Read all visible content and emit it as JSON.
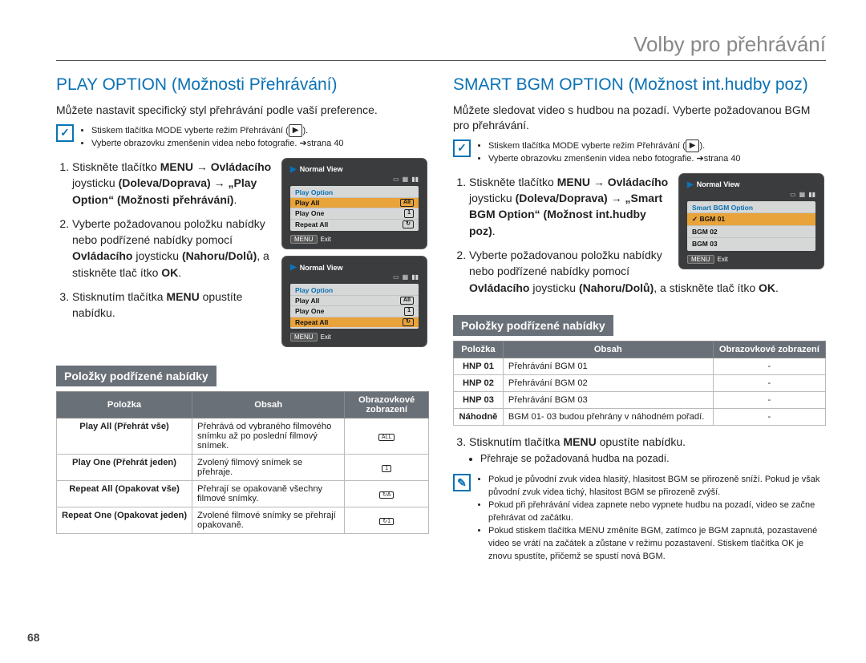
{
  "header": {
    "title": "Volby pro přehrávání"
  },
  "page_number": "68",
  "left": {
    "heading": "PLAY OPTION (Možnosti Přehrávání)",
    "intro": "Můžete nastavit specifický styl přehrávání podle vaší preference.",
    "note1": "Stiskem tlačítka MODE vyberte režim Přehrávání (",
    "note1b": ").",
    "note2": "Vyberte obrazovku zmenšenin videa nebo fotografie. ➔strana 40",
    "steps": {
      "s1a": "Stiskněte tlačítko ",
      "s1b_menu": "MENU",
      "s1c": " → ",
      "s1d": "Ovládacího",
      "s1e": " joysticku ",
      "s1f": "(Doleva/Doprava)",
      "s1g": " → ",
      "s1h": "„Play Option“ (Možnosti přehrávání)",
      "s1i": ".",
      "s2a": "Vyberte požadovanou položku nabídky nebo podřízené nabídky pomocí ",
      "s2b": "Ovládacího",
      "s2c": " joysticku ",
      "s2d": "(Nahoru/Dolů)",
      "s2e": ", a stiskněte tlač ítko ",
      "s2f": "OK",
      "s2g": ".",
      "s3a": "Stisknutím tlačítka ",
      "s3b": "MENU",
      "s3c": " opustíte nabídku."
    },
    "submenu_title": "Položky podřízené nabídky",
    "table": {
      "h1": "Položka",
      "h2": "Obsah",
      "h3": "Obrazovkové zobrazení",
      "r1n": "Play All\n(Přehrát vše)",
      "r1d": "Přehrává od vybraného filmového snímku až po poslední filmový snímek.",
      "r1i": "ALL",
      "r2n": "Play One\n(Přehrát jeden)",
      "r2d": "Zvolený filmový snímek se přehraje.",
      "r2i": "1",
      "r3n": "Repeat All\n(Opakovat vše)",
      "r3d": "Přehrají se opakovaně všechny filmové snímky.",
      "r3i": "↻A",
      "r4n": "Repeat One\n(Opakovat jeden)",
      "r4d": "Zvolené filmové snímky se přehrají opakovaně.",
      "r4i": "↻1"
    },
    "device1": {
      "title": "Normal View",
      "menu_head": "Play Option",
      "rows": [
        {
          "label": "Play All",
          "mark": "All",
          "hl": true
        },
        {
          "label": "Play One",
          "mark": "1"
        },
        {
          "label": "Repeat All",
          "mark": "↻"
        }
      ],
      "foot_menu": "MENU",
      "foot_exit": "Exit"
    },
    "device2": {
      "title": "Normal View",
      "menu_head": "Play Option",
      "rows": [
        {
          "label": "Play All",
          "mark": "All"
        },
        {
          "label": "Play One",
          "mark": "1"
        },
        {
          "label": "Repeat All",
          "mark": "↻",
          "hl": true
        }
      ],
      "foot_menu": "MENU",
      "foot_exit": "Exit"
    }
  },
  "right": {
    "heading": "SMART BGM OPTION (Možnost int.hudby poz)",
    "intro": "Můžete sledovat video s hudbou na pozadí. Vyberte požadovanou BGM pro přehrávání.",
    "note1": "Stiskem tlačítka MODE vyberte režim Přehrávání (",
    "note1b": ").",
    "note2": "Vyberte obrazovku zmenšenin videa nebo fotografie. ➔strana 40",
    "steps": {
      "s1a": "Stiskněte tlačítko ",
      "s1b_menu": "MENU",
      "s1c": " → ",
      "s1d": "Ovládacího",
      "s1e": " joysticku ",
      "s1f": "(Doleva/Doprava)",
      "s1g": " → ",
      "s1h": "„Smart BGM Option“ (Možnost int.hudby poz)",
      "s1i": ".",
      "s2a": "Vyberte požadovanou položku nabídky nebo podřízené nabídky pomocí ",
      "s2b": "Ovládacího",
      "s2c": " joysticku ",
      "s2d": "(Nahoru/Dolů)",
      "s2e": ", a stiskněte tlač ítko ",
      "s2f": "OK",
      "s2g": "."
    },
    "submenu_title": "Položky podřízené nabídky",
    "table": {
      "h1": "Položka",
      "h2": "Obsah",
      "h3": "Obrazovkové zobrazení",
      "r1n": "HNP 01",
      "r1d": "Přehrávání BGM 01",
      "r1i": "-",
      "r2n": "HNP 02",
      "r2d": "Přehrávání BGM 02",
      "r2i": "-",
      "r3n": "HNP 03",
      "r3d": "Přehrávání BGM 03",
      "r3i": "-",
      "r4n": "Náhodně",
      "r4d": "BGM 01- 03 budou přehrány v náhodném pořadí.",
      "r4i": "-"
    },
    "step3a": "Stisknutím tlačítka ",
    "step3b": "MENU",
    "step3c": " opustíte nabídku.",
    "step3bullet": "Přehraje se požadovaná hudba na pozadí.",
    "tips": [
      "Pokud je původní zvuk videa hlasitý, hlasitost BGM se přirozeně sníží. Pokud je však původní zvuk videa tichý, hlasitost BGM se přirozeně zvýší.",
      "Pokud při přehrávání videa zapnete nebo vypnete hudbu na pozadí, video se začne přehrávat od začátku.",
      "Pokud stiskem tlačítka MENU změníte BGM, zatímco je BGM zapnutá, pozastavené video se vrátí na začátek a zůstane v režimu pozastavení. Stiskem tlačítka OK je znovu spustíte, přičemž se spustí nová BGM."
    ],
    "device": {
      "title": "Normal View",
      "menu_head": "Smart BGM Option",
      "rows": [
        {
          "label": "BGM 01",
          "mark": "✓",
          "hl": true
        },
        {
          "label": "BGM 02",
          "mark": ""
        },
        {
          "label": "BGM 03",
          "mark": ""
        }
      ],
      "foot_menu": "MENU",
      "foot_exit": "Exit"
    }
  }
}
